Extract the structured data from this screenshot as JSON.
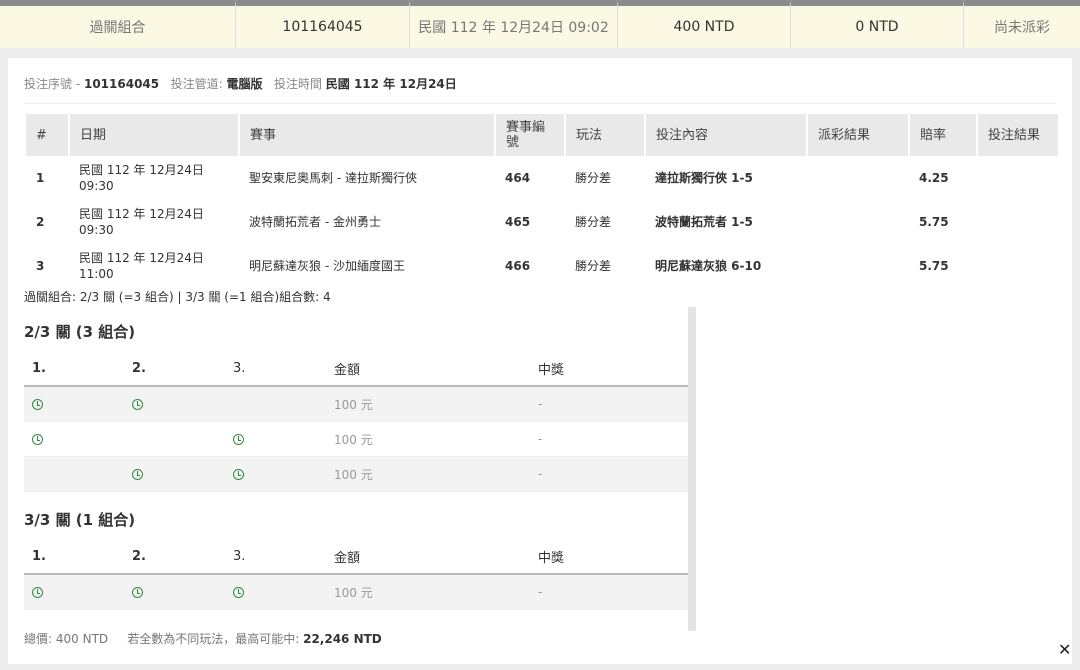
{
  "summary": {
    "type": "過關組合",
    "ticket_no": "101164045",
    "time": "民國 112 年 12月24日 09:02",
    "amount": "400 NTD",
    "payout": "0 NTD",
    "status": "尚未派彩"
  },
  "meta": {
    "serial_label": "投注序號 -",
    "serial_value": "101164045",
    "channel_label": "投注管道:",
    "channel_value": "電腦版",
    "time_label": "投注時間",
    "time_value": "民國 112 年 12月24日"
  },
  "table": {
    "headers": [
      "#",
      "日期",
      "賽事",
      "賽事編號",
      "玩法",
      "投注內容",
      "派彩結果",
      "賠率",
      "投注結果"
    ],
    "rows": [
      {
        "no": "1",
        "date1": "民國 112 年 12月24日",
        "date2": "09:30",
        "match": "聖安東尼奧馬刺 - 達拉斯獨行俠",
        "id": "464",
        "play": "勝分差",
        "pick": "達拉斯獨行俠 1-5",
        "result": "",
        "odds": "4.25",
        "outcome": ""
      },
      {
        "no": "2",
        "date1": "民國 112 年 12月24日",
        "date2": "09:30",
        "match": "波特蘭拓荒者 - 金州勇士",
        "id": "465",
        "play": "勝分差",
        "pick": "波特蘭拓荒者 1-5",
        "result": "",
        "odds": "5.75",
        "outcome": ""
      },
      {
        "no": "3",
        "date1": "民國 112 年 12月24日",
        "date2": "11:00",
        "match": "明尼蘇達灰狼 - 沙加緬度國王",
        "id": "466",
        "play": "勝分差",
        "pick": "明尼蘇達灰狼 6-10",
        "result": "",
        "odds": "5.75",
        "outcome": ""
      }
    ]
  },
  "combo_note": "過關組合: 2/3 關 (=3 組合) | 3/3 關 (=1 組合)組合數: 4",
  "group1": {
    "title": "2/3 關 (3 組合)",
    "headers": [
      "1.",
      "2.",
      "3.",
      "金額",
      "中獎"
    ],
    "rows": [
      {
        "amount": "100 元",
        "win": "-"
      },
      {
        "amount": "100 元",
        "win": "-"
      },
      {
        "amount": "100 元",
        "win": "-"
      }
    ]
  },
  "group2": {
    "title": "3/3 關 (1 組合)",
    "headers": [
      "1.",
      "2.",
      "3.",
      "金額",
      "中獎"
    ],
    "rows": [
      {
        "amount": "100 元",
        "win": "-"
      }
    ]
  },
  "footer": {
    "total_label": "總價:",
    "total_value": "400 NTD",
    "max_label": "若全數為不同玩法，最高可能中:",
    "max_value": "22,246 NTD"
  },
  "close_icon": "close-icon",
  "colors": {
    "accent_green": "#2e8b3d",
    "strip_bg": "#fbf9e4"
  }
}
